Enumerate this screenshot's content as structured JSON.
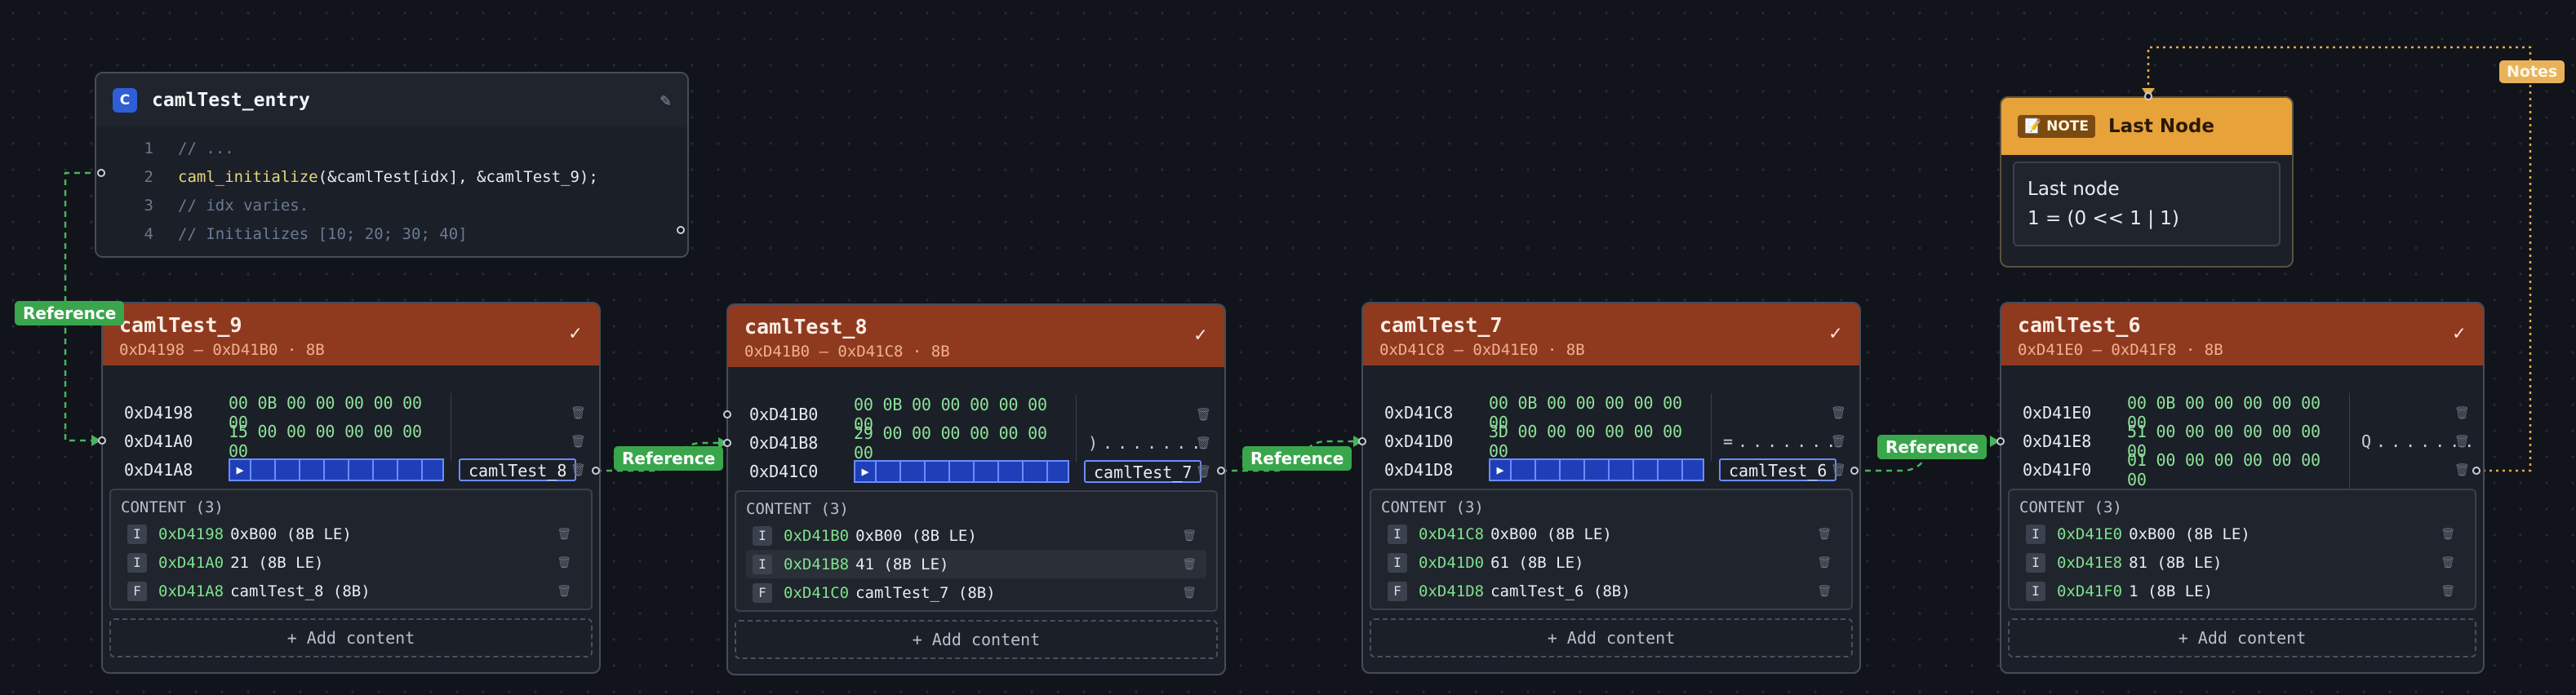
{
  "code_node": {
    "badge": "C",
    "title": "camlTest_entry",
    "lines": [
      {
        "num": "1",
        "text": "// ..."
      },
      {
        "num": "2",
        "fn": "caml_initialize",
        "rest": "(&camlTest[idx], &camlTest_9);"
      },
      {
        "num": "3",
        "text": "// idx varies."
      },
      {
        "num": "4",
        "text": "// Initializes [10; 20; 30; 40]"
      }
    ]
  },
  "note_node": {
    "badge": "NOTE",
    "title": "Last Node",
    "body": [
      "Last node",
      "1 = (0 << 1 | 1)"
    ]
  },
  "edge_labels": {
    "ref": "Reference",
    "notes": "Notes"
  },
  "blocks": [
    {
      "name": "camlTest_9",
      "range": "0xD4198 – 0xD41B0 · 8B",
      "rows": [
        {
          "addr": "0xD4198",
          "hex": "00 0B 00 00 00 00 00 00",
          "ascii": ""
        },
        {
          "addr": "0xD41A0",
          "hex": "15 00 00 00 00 00 00 00",
          "ascii": ""
        },
        {
          "addr": "0xD41A8",
          "ptr": "camlTest_8"
        }
      ],
      "content_title": "CONTENT (3)",
      "content": [
        {
          "type": "I",
          "addr": "0xD4198",
          "val": "0xB00 (8B LE)"
        },
        {
          "type": "I",
          "addr": "0xD41A0",
          "val": "21 (8B LE)"
        },
        {
          "type": "F",
          "addr": "0xD41A8",
          "val": "camlTest_8 (8B)"
        }
      ],
      "add": "+ Add content"
    },
    {
      "name": "camlTest_8",
      "range": "0xD41B0 – 0xD41C8 · 8B",
      "rows": [
        {
          "addr": "0xD41B0",
          "hex": "00 0B 00 00 00 00 00 00",
          "ascii": ""
        },
        {
          "addr": "0xD41B8",
          "hex": "29 00 00 00 00 00 00 00",
          "ascii": ")......."
        },
        {
          "addr": "0xD41C0",
          "ptr": "camlTest_7"
        }
      ],
      "content_title": "CONTENT (3)",
      "content": [
        {
          "type": "I",
          "addr": "0xD41B0",
          "val": "0xB00 (8B LE)"
        },
        {
          "type": "I",
          "addr": "0xD41B8",
          "val": "41 (8B LE)"
        },
        {
          "type": "F",
          "addr": "0xD41C0",
          "val": "camlTest_7 (8B)"
        }
      ],
      "add": "+ Add content"
    },
    {
      "name": "camlTest_7",
      "range": "0xD41C8 – 0xD41E0 · 8B",
      "rows": [
        {
          "addr": "0xD41C8",
          "hex": "00 0B 00 00 00 00 00 00",
          "ascii": ""
        },
        {
          "addr": "0xD41D0",
          "hex": "3D 00 00 00 00 00 00 00",
          "ascii": "=......."
        },
        {
          "addr": "0xD41D8",
          "ptr": "camlTest_6"
        }
      ],
      "content_title": "CONTENT (3)",
      "content": [
        {
          "type": "I",
          "addr": "0xD41C8",
          "val": "0xB00 (8B LE)"
        },
        {
          "type": "I",
          "addr": "0xD41D0",
          "val": "61 (8B LE)"
        },
        {
          "type": "F",
          "addr": "0xD41D8",
          "val": "camlTest_6 (8B)"
        }
      ],
      "add": "+ Add content"
    },
    {
      "name": "camlTest_6",
      "range": "0xD41E0 – 0xD41F8 · 8B",
      "rows": [
        {
          "addr": "0xD41E0",
          "hex": "00 0B 00 00 00 00 00 00",
          "ascii": ""
        },
        {
          "addr": "0xD41E8",
          "hex": "51 00 00 00 00 00 00 00",
          "ascii": "Q......."
        },
        {
          "addr": "0xD41F0",
          "hex": "01 00 00 00 00 00 00 00",
          "ascii": ""
        }
      ],
      "content_title": "CONTENT (3)",
      "content": [
        {
          "type": "I",
          "addr": "0xD41E0",
          "val": "0xB00 (8B LE)"
        },
        {
          "type": "I",
          "addr": "0xD41E8",
          "val": "81 (8B LE)"
        },
        {
          "type": "I",
          "addr": "0xD41F0",
          "val": "1 (8B LE)"
        }
      ],
      "add": "+ Add content"
    }
  ]
}
